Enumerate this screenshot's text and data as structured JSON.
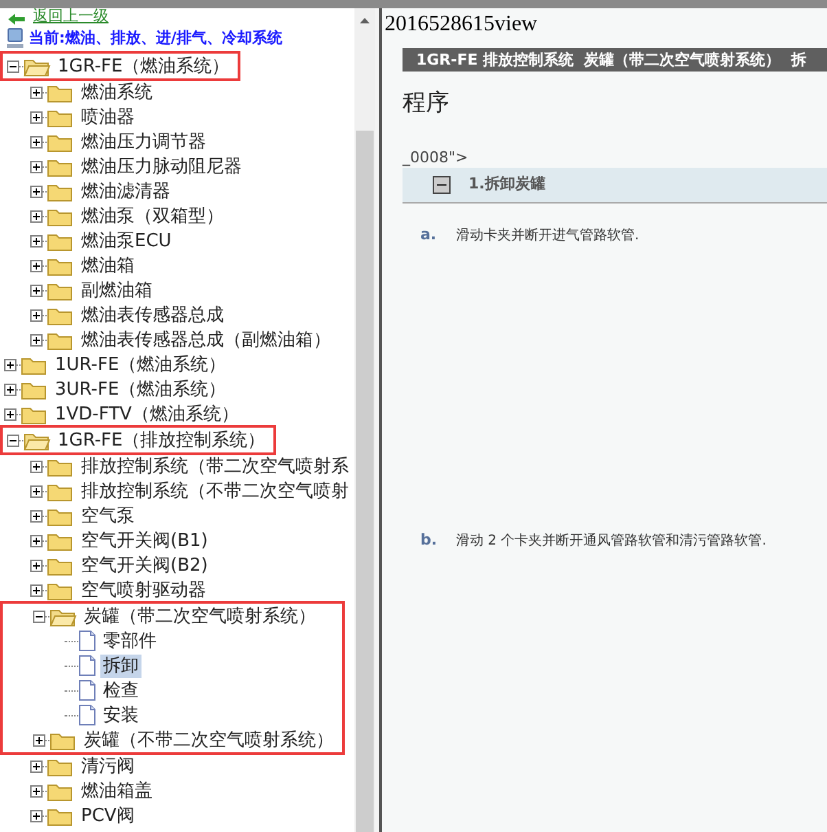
{
  "sidebar": {
    "back_link": "返回上一级",
    "current_path": "当前:燃油、排放、进/排气、冷却系统",
    "tree": [
      {
        "label": "1GR-FE（燃油系统）",
        "kind": "folder",
        "expanded": true,
        "annotated": true,
        "selected": false,
        "children": [
          {
            "label": "燃油系统",
            "kind": "folder",
            "expanded": false,
            "annotated": false,
            "selected": false
          },
          {
            "label": "喷油器",
            "kind": "folder",
            "expanded": false,
            "annotated": false,
            "selected": false
          },
          {
            "label": "燃油压力调节器",
            "kind": "folder",
            "expanded": false,
            "annotated": false,
            "selected": false
          },
          {
            "label": "燃油压力脉动阻尼器",
            "kind": "folder",
            "expanded": false,
            "annotated": false,
            "selected": false
          },
          {
            "label": "燃油滤清器",
            "kind": "folder",
            "expanded": false,
            "annotated": false,
            "selected": false
          },
          {
            "label": "燃油泵（双箱型）",
            "kind": "folder",
            "expanded": false,
            "annotated": false,
            "selected": false
          },
          {
            "label": "燃油泵ECU",
            "kind": "folder",
            "expanded": false,
            "annotated": false,
            "selected": false
          },
          {
            "label": "燃油箱",
            "kind": "folder",
            "expanded": false,
            "annotated": false,
            "selected": false
          },
          {
            "label": "副燃油箱",
            "kind": "folder",
            "expanded": false,
            "annotated": false,
            "selected": false
          },
          {
            "label": "燃油表传感器总成",
            "kind": "folder",
            "expanded": false,
            "annotated": false,
            "selected": false
          },
          {
            "label": "燃油表传感器总成（副燃油箱）",
            "kind": "folder",
            "expanded": false,
            "annotated": false,
            "selected": false
          }
        ]
      },
      {
        "label": "1UR-FE（燃油系统）",
        "kind": "folder",
        "expanded": false,
        "annotated": false,
        "selected": false
      },
      {
        "label": "3UR-FE（燃油系统）",
        "kind": "folder",
        "expanded": false,
        "annotated": false,
        "selected": false
      },
      {
        "label": "1VD-FTV（燃油系统）",
        "kind": "folder",
        "expanded": false,
        "annotated": false,
        "selected": false
      },
      {
        "label": "1GR-FE（排放控制系统）",
        "kind": "folder",
        "expanded": true,
        "annotated": true,
        "selected": false,
        "children": [
          {
            "label": "排放控制系统（带二次空气喷射系",
            "kind": "folder",
            "expanded": false,
            "annotated": false,
            "selected": false
          },
          {
            "label": "排放控制系统（不带二次空气喷射",
            "kind": "folder",
            "expanded": false,
            "annotated": false,
            "selected": false
          },
          {
            "label": "空气泵",
            "kind": "folder",
            "expanded": false,
            "annotated": false,
            "selected": false
          },
          {
            "label": "空气开关阀(B1)",
            "kind": "folder",
            "expanded": false,
            "annotated": false,
            "selected": false
          },
          {
            "label": "空气开关阀(B2)",
            "kind": "folder",
            "expanded": false,
            "annotated": false,
            "selected": false
          },
          {
            "label": "空气喷射驱动器",
            "kind": "folder",
            "expanded": false,
            "annotated": false,
            "selected": false
          },
          {
            "kind": "group",
            "annotated": true,
            "children": [
              {
                "label": "炭罐（带二次空气喷射系统）",
                "kind": "folder",
                "expanded": true,
                "annotated": false,
                "selected": false,
                "children": [
                  {
                    "label": "零部件",
                    "kind": "page",
                    "selected": false
                  },
                  {
                    "label": "拆卸",
                    "kind": "page",
                    "selected": true
                  },
                  {
                    "label": "检查",
                    "kind": "page",
                    "selected": false
                  },
                  {
                    "label": "安装",
                    "kind": "page",
                    "selected": false
                  }
                ]
              },
              {
                "label": "炭罐（不带二次空气喷射系统）",
                "kind": "folder",
                "expanded": false,
                "annotated": false,
                "selected": false
              }
            ]
          },
          {
            "label": "清污阀",
            "kind": "folder",
            "expanded": false,
            "annotated": false,
            "selected": false
          },
          {
            "label": "燃油箱盖",
            "kind": "folder",
            "expanded": false,
            "annotated": false,
            "selected": false
          },
          {
            "label": "PCV阀",
            "kind": "folder",
            "expanded": false,
            "annotated": false,
            "selected": false
          }
        ]
      }
    ]
  },
  "document": {
    "page_title": "2016528615view",
    "header": "1GR-FE 排放控制系统  炭罐（带二次空气喷射系统）  拆",
    "heading": "程序",
    "stray_text": "_0008\">",
    "section": {
      "title": "1.拆卸炭罐",
      "expanded": true
    },
    "steps": [
      {
        "marker": "a.",
        "text": "滑动卡夹并断开进气管路软管."
      },
      {
        "marker": "b.",
        "text": "滑动 2 个卡夹并断开通风管路软管和清污管路软管."
      }
    ]
  }
}
